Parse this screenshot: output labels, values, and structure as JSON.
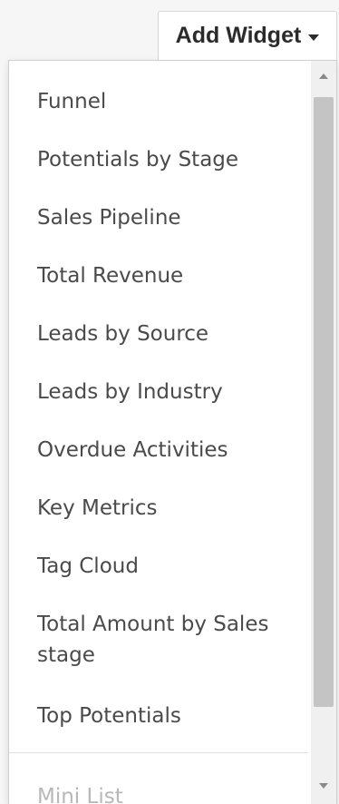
{
  "add_widget": {
    "label": "Add Widget",
    "caret_icon": "caret-down-icon"
  },
  "menu": {
    "items": [
      "Funnel",
      "Potentials by Stage",
      "Sales Pipeline",
      "Total Revenue",
      "Leads by Source",
      "Leads by Industry",
      "Overdue Activities",
      "Key Metrics",
      "Tag Cloud",
      "Total Amount by Sales stage",
      "Top Potentials",
      "Mini List"
    ]
  },
  "scrollbar": {
    "up_icon": "scroll-up-arrow-icon",
    "down_icon": "scroll-down-arrow-icon"
  }
}
